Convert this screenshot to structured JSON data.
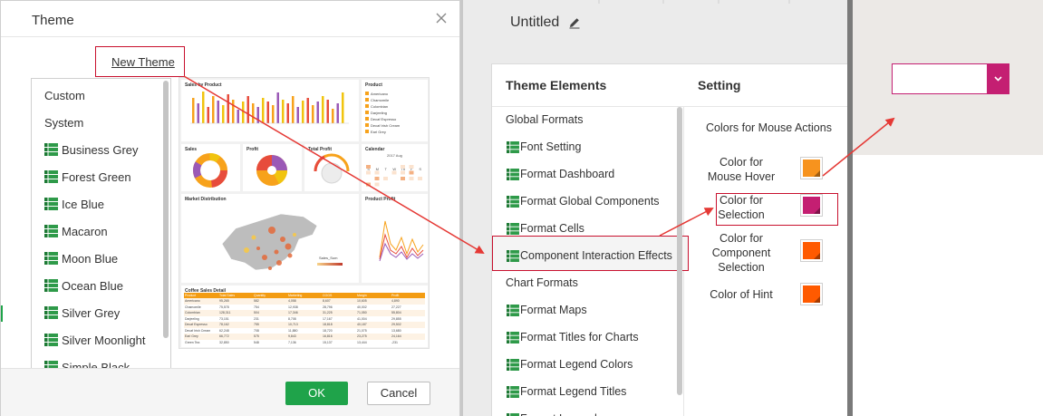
{
  "dialog": {
    "title": "Theme",
    "new_theme_label": "New Theme",
    "ok_label": "OK",
    "cancel_label": "Cancel",
    "themes": [
      {
        "label": "Custom",
        "icon": "none"
      },
      {
        "label": "System",
        "icon": "none"
      },
      {
        "label": "Business Grey",
        "icon": "grid-icon"
      },
      {
        "label": "Forest Green",
        "icon": "grid-icon"
      },
      {
        "label": "Ice Blue",
        "icon": "grid-icon"
      },
      {
        "label": "Macaron",
        "icon": "grid-icon"
      },
      {
        "label": "Moon Blue",
        "icon": "grid-icon"
      },
      {
        "label": "Ocean Blue",
        "icon": "grid-icon"
      },
      {
        "label": "Silver Grey",
        "icon": "grid-icon"
      },
      {
        "label": "Silver Moonlight",
        "icon": "grid-icon"
      },
      {
        "label": "Simple Black",
        "icon": "grid-icon"
      }
    ],
    "preview": {
      "sales_by_product": "Sales by Product",
      "product": "Product",
      "product_items": [
        "Americano",
        "Chamomile",
        "Colombian",
        "Darjeeling",
        "Decaf Espresso",
        "Decaf Irish Cream",
        "Earl Grey"
      ],
      "sales": "Sales",
      "profit": "Profit",
      "total_profit": "Total Profit",
      "calendar": "Calendar",
      "calendar_month": "2017 Aug",
      "weekdays": [
        "S",
        "M",
        "T",
        "W",
        "Th",
        "F",
        "S"
      ],
      "market_distribution": "Market Distribution",
      "product_profit": "Product Profit",
      "sales_sum": "Sales_Sum",
      "coffee_detail": "Coffee Sales Detail",
      "table_header": [
        "Product",
        "Total Sales",
        "Quantity",
        "Marketing",
        "COGS",
        "Margin",
        "Profit"
      ],
      "table_rows": [
        [
          "Americano",
          "95,265",
          "582",
          "4,058",
          "8,607",
          "10,605",
          "4,890"
        ],
        [
          "Chamomile",
          "75,578",
          "754",
          "12,938",
          "28,796",
          "40,002",
          "27,227"
        ],
        [
          "Colombian",
          "128,311",
          "504",
          "17,346",
          "31,225",
          "71,050",
          "55,804"
        ],
        [
          "Darjeeling",
          "73,151",
          "231",
          "8,708",
          "17,167",
          "41,004",
          "29,855"
        ],
        [
          "Decaf Espresso",
          "78,162",
          "755",
          "10,713",
          "18,818",
          "40,187",
          "29,502"
        ],
        [
          "Decaf Irish Cream",
          "62,248",
          "708",
          "11,880",
          "18,720",
          "21,075",
          "13,680"
        ],
        [
          "Earl Grey",
          "66,772",
          "575",
          "9,843",
          "16,816",
          "23,275",
          "24,164"
        ],
        [
          "Green Tea",
          "32,850",
          "548",
          "7,136",
          "15,137",
          "13,444",
          "-231"
        ]
      ],
      "colors": {
        "orange": "#f7a21b",
        "purple": "#9b59b6",
        "red": "#e74c3c",
        "yellow": "#f1c40f",
        "header": "#f39c12"
      }
    }
  },
  "editor": {
    "title": "Untitled",
    "elements_header": "Theme Elements",
    "setting_header": "Setting",
    "elements": [
      {
        "label": "Global Formats",
        "icon": "none"
      },
      {
        "label": "Font Setting",
        "icon": "grid-icon"
      },
      {
        "label": "Format Dashboard",
        "icon": "grid-icon"
      },
      {
        "label": "Format Global Components",
        "icon": "grid-icon"
      },
      {
        "label": "Format Cells",
        "icon": "grid-icon"
      },
      {
        "label": "Component Interaction Effects",
        "icon": "grid-icon"
      },
      {
        "label": "Chart Formats",
        "icon": "none"
      },
      {
        "label": "Format Maps",
        "icon": "grid-icon"
      },
      {
        "label": "Format Titles for Charts",
        "icon": "grid-icon"
      },
      {
        "label": "Format Legend Colors",
        "icon": "grid-icon"
      },
      {
        "label": "Format Legend Titles",
        "icon": "grid-icon"
      },
      {
        "label": "Format Legend",
        "icon": "grid-icon"
      }
    ],
    "settings": {
      "section_title": "Colors for Mouse Actions",
      "items": [
        {
          "label_line1": "Color for",
          "label_line2": "Mouse Hover",
          "label_line3": "",
          "color": "#f7931e"
        },
        {
          "label_line1": "Color for",
          "label_line2": "Selection",
          "label_line3": "",
          "color": "#c41f72"
        },
        {
          "label_line1": "Color for",
          "label_line2": "Component",
          "label_line3": "Selection",
          "color": "#ff5a00"
        },
        {
          "label_line1": "Color of Hint",
          "label_line2": "",
          "label_line3": "",
          "color": "#ff5a00"
        }
      ]
    }
  },
  "combo": {
    "accent_color": "#c41f72",
    "arrow_icon": "chevron-down-icon"
  },
  "annotation_color": "#e53935"
}
